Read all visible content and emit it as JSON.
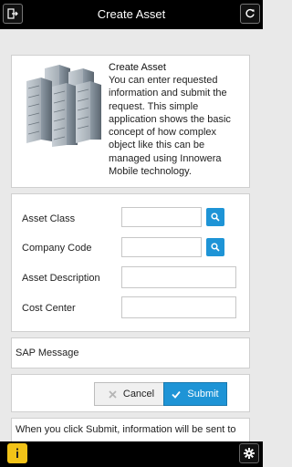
{
  "header": {
    "title": "Create Asset",
    "left_icon": "exit-icon",
    "right_icon": "refresh-icon"
  },
  "intro": {
    "image": "office-buildings-icon",
    "heading": "Create Asset",
    "description": "You can enter requested information and submit the request. This simple application shows the basic concept of how complex object like this can be managed using Innowera Mobile technology."
  },
  "form": {
    "asset_class_label": "Asset Class",
    "asset_class_value": "",
    "company_code_label": "Company Code",
    "company_code_value": "",
    "asset_description_label": "Asset Description",
    "asset_description_value": "",
    "cost_center_label": "Cost Center",
    "cost_center_value": "",
    "lookup_icon": "search-icon"
  },
  "sap_message": {
    "label": "SAP Message"
  },
  "actions": {
    "cancel_label": "Cancel",
    "submit_label": "Submit"
  },
  "info": {
    "text": "When you click Submit, information will be sent to"
  },
  "footer": {
    "info_icon": "info-icon",
    "settings_icon": "gear-icon"
  },
  "colors": {
    "accent": "#1e94d6",
    "header_bg": "#000000",
    "info_button": "#f2c318",
    "page_bg": "#e9e9e9"
  }
}
